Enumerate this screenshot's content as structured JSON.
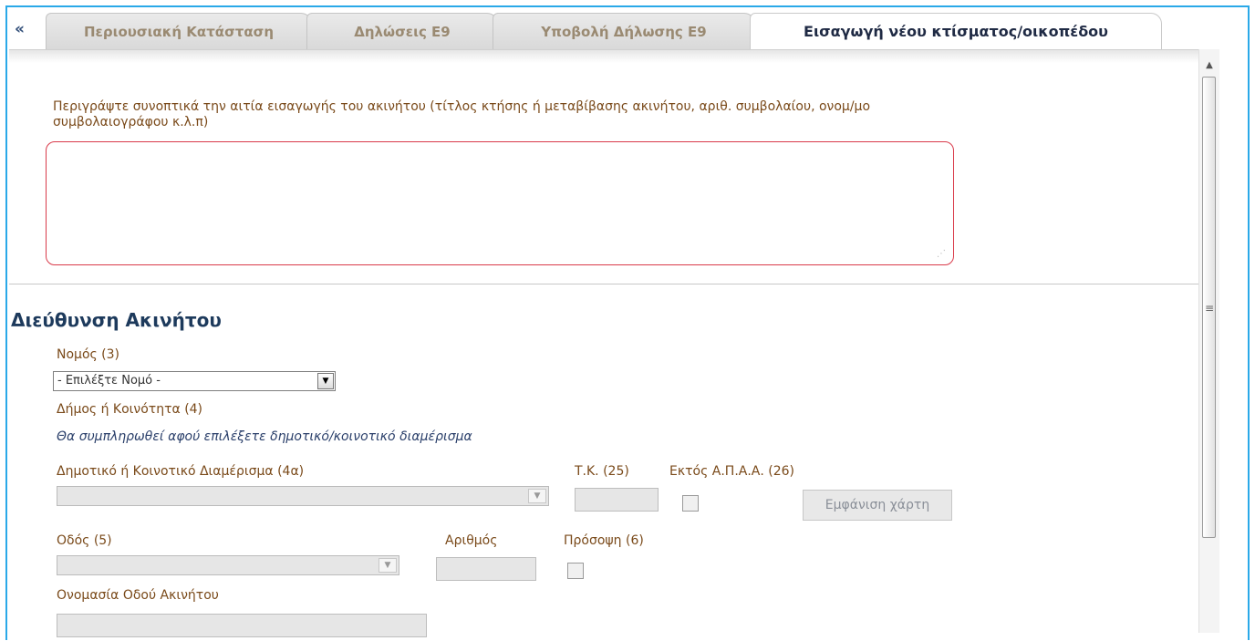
{
  "tabs": {
    "scroll_left": "«",
    "items": [
      {
        "label": "Περιουσιακή Κατάσταση"
      },
      {
        "label": "Δηλώσεις Ε9"
      },
      {
        "label": "Υποβολή Δήλωσης Ε9"
      },
      {
        "label": "Εισαγωγή νέου κτίσματος/οικοπέδου"
      }
    ]
  },
  "form": {
    "description_label": "Περιγράψτε συνοπτικά την αιτία εισαγωγής του ακινήτου (τίτλος κτήσης ή μεταβίβασης ακινήτου, αριθ. συμβολαίου, ονομ/μο συμβολαιογράφου κ.λ.π)",
    "description_value": "",
    "section_title": "Διεύθυνση Ακινήτου",
    "nomos_label": "Νομός (3)",
    "nomos_selected": "- Επιλέξτε Νομό -",
    "dimos_label": "Δήμος ή Κοινότητα (4)",
    "dimos_note": "Θα συμπληρωθεί αφού επιλέξετε δημοτικό/κοινοτικό διαμέρισμα",
    "diamerisma_label": "Δημοτικό ή Κοινοτικό Διαμέρισμα (4α)",
    "tk_label": "Τ.Κ. (25)",
    "ektos_label": "Εκτός Α.Π.Α.Α. (26)",
    "map_button": "Εμφάνιση χάρτη",
    "odos_label": "Οδός (5)",
    "arithmos_label": "Αριθμός",
    "prosopsi_label": "Πρόσοψη (6)",
    "onomasia_label": "Ονομασία Οδού Ακινήτου"
  },
  "icons": {
    "dropdown": "▼",
    "scroll_up": "▲",
    "grip": "≡",
    "resize": "⋰"
  }
}
